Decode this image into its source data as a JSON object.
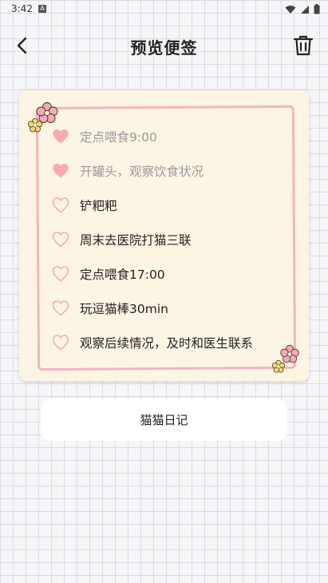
{
  "status_bar": {
    "time": "3:42",
    "notification_glyph": "A"
  },
  "header": {
    "title": "预览便签"
  },
  "note": {
    "items": [
      {
        "text": "定点喂食9:00",
        "done": true
      },
      {
        "text": "开罐头，观察饮食状况",
        "done": true
      },
      {
        "text": "铲粑粑",
        "done": false
      },
      {
        "text": "周末去医院打猫三联",
        "done": false
      },
      {
        "text": "定点喂食17:00",
        "done": false
      },
      {
        "text": "玩逗猫棒30min",
        "done": false
      },
      {
        "text": "观察后续情况，及时和医生联系",
        "done": false
      }
    ]
  },
  "footer": {
    "diary_button": "猫猫日记"
  },
  "colors": {
    "accent_pink": "#f8a9b4",
    "frame_pink": "#f2b6be",
    "note_background": "#fdf5e4",
    "done_text": "#9a9a9a",
    "flower_yellow": "#f7d66a"
  },
  "icons": {
    "back": "chevron-left-icon",
    "delete": "trash-icon",
    "checked": "heart-filled-icon",
    "unchecked": "heart-outline-icon",
    "decoration": "flower-icon"
  }
}
